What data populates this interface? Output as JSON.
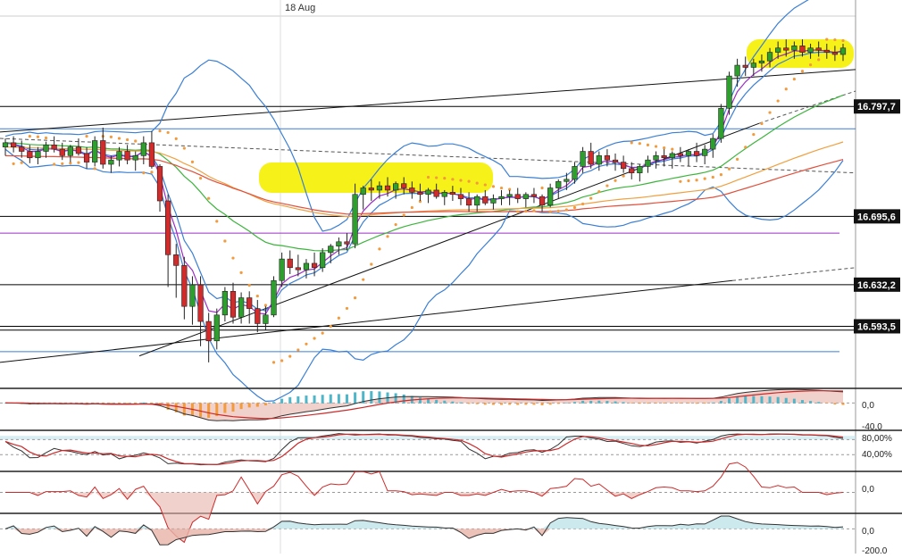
{
  "header": {
    "date_label": "18 Aug"
  },
  "colors": {
    "bull": "#2e9e2e",
    "bear": "#d12b2b",
    "bollinger": "#3a7fd5",
    "ema_fast": "#9b2fc4",
    "ema_mid": "#3cb43c",
    "ema_slow": "#e0503c",
    "ma_orange": "#f0a040",
    "sar": "#f39a3b",
    "highlight": "#f5f000",
    "level_line": "#000000",
    "hline_blue": "#3a7fd5",
    "hline_purple": "#9b2fc4",
    "macd_hist_pos": "#4fb6c9",
    "macd_hist_neg": "#f39a3b",
    "signal_red": "#cc2a2a",
    "panel_fill": "#bfe3ea",
    "neg_fill": "#e8b3a8"
  },
  "chart_data": [
    {
      "type": "candlestick",
      "title": "",
      "x_label": "18 Aug",
      "ylim": [
        16540,
        16880
      ],
      "price_labels": [
        "16.797,7",
        "16.695,6",
        "16.632,2",
        "16.593,5"
      ],
      "price_levels": [
        16797.7,
        16695.6,
        16632.2,
        16593.5
      ],
      "candles": [
        [
          16760,
          16768,
          16752,
          16764
        ],
        [
          16764,
          16770,
          16755,
          16760
        ],
        [
          16760,
          16766,
          16750,
          16756
        ],
        [
          16756,
          16762,
          16745,
          16750
        ],
        [
          16750,
          16760,
          16744,
          16756
        ],
        [
          16756,
          16765,
          16750,
          16762
        ],
        [
          16762,
          16770,
          16755,
          16758
        ],
        [
          16758,
          16764,
          16748,
          16752
        ],
        [
          16752,
          16762,
          16746,
          16760
        ],
        [
          16760,
          16768,
          16752,
          16754
        ],
        [
          16754,
          16760,
          16740,
          16746
        ],
        [
          16746,
          16770,
          16742,
          16766
        ],
        [
          16766,
          16778,
          16740,
          16744
        ],
        [
          16744,
          16752,
          16736,
          16748
        ],
        [
          16748,
          16760,
          16742,
          16756
        ],
        [
          16756,
          16762,
          16744,
          16748
        ],
        [
          16748,
          16756,
          16738,
          16752
        ],
        [
          16752,
          16770,
          16744,
          16764
        ],
        [
          16764,
          16775,
          16740,
          16742
        ],
        [
          16742,
          16744,
          16700,
          16710
        ],
        [
          16710,
          16716,
          16630,
          16660
        ],
        [
          16660,
          16670,
          16620,
          16650
        ],
        [
          16650,
          16658,
          16600,
          16612
        ],
        [
          16612,
          16640,
          16595,
          16632
        ],
        [
          16632,
          16640,
          16575,
          16598
        ],
        [
          16598,
          16606,
          16560,
          16580
        ],
        [
          16580,
          16610,
          16572,
          16604
        ],
        [
          16604,
          16630,
          16598,
          16626
        ],
        [
          16626,
          16634,
          16596,
          16602
        ],
        [
          16602,
          16625,
          16596,
          16620
        ],
        [
          16620,
          16626,
          16596,
          16610
        ],
        [
          16610,
          16618,
          16588,
          16596
        ],
        [
          16596,
          16612,
          16590,
          16604
        ],
        [
          16604,
          16640,
          16602,
          16636
        ],
        [
          16636,
          16662,
          16630,
          16656
        ],
        [
          16656,
          16664,
          16642,
          16648
        ],
        [
          16648,
          16660,
          16640,
          16646
        ],
        [
          16646,
          16656,
          16638,
          16652
        ],
        [
          16652,
          16662,
          16640,
          16648
        ],
        [
          16648,
          16666,
          16644,
          16662
        ],
        [
          16662,
          16670,
          16652,
          16668
        ],
        [
          16668,
          16676,
          16660,
          16672
        ],
        [
          16672,
          16680,
          16664,
          16670
        ],
        [
          16670,
          16726,
          16666,
          16716
        ],
        [
          16716,
          16724,
          16702,
          16722
        ],
        [
          16722,
          16730,
          16710,
          16720
        ],
        [
          16720,
          16728,
          16712,
          16724
        ],
        [
          16724,
          16732,
          16714,
          16720
        ],
        [
          16720,
          16728,
          16712,
          16726
        ],
        [
          16726,
          16732,
          16716,
          16722
        ],
        [
          16722,
          16728,
          16712,
          16718
        ],
        [
          16718,
          16726,
          16710,
          16716
        ],
        [
          16716,
          16722,
          16708,
          16720
        ],
        [
          16720,
          16726,
          16712,
          16714
        ],
        [
          16714,
          16720,
          16706,
          16718
        ],
        [
          16718,
          16724,
          16710,
          16716
        ],
        [
          16716,
          16722,
          16706,
          16712
        ],
        [
          16712,
          16718,
          16700,
          16706
        ],
        [
          16706,
          16716,
          16700,
          16714
        ],
        [
          16714,
          16720,
          16706,
          16708
        ],
        [
          16708,
          16716,
          16702,
          16712
        ],
        [
          16712,
          16720,
          16706,
          16714
        ],
        [
          16714,
          16720,
          16706,
          16716
        ],
        [
          16716,
          16722,
          16708,
          16712
        ],
        [
          16712,
          16718,
          16704,
          16716
        ],
        [
          16716,
          16722,
          16708,
          16714
        ],
        [
          16714,
          16716,
          16700,
          16706
        ],
        [
          16706,
          16726,
          16704,
          16722
        ],
        [
          16722,
          16730,
          16712,
          16728
        ],
        [
          16728,
          16736,
          16720,
          16730
        ],
        [
          16730,
          16746,
          16726,
          16742
        ],
        [
          16742,
          16760,
          16736,
          16756
        ],
        [
          16756,
          16764,
          16740,
          16744
        ],
        [
          16744,
          16756,
          16738,
          16752
        ],
        [
          16752,
          16758,
          16742,
          16748
        ],
        [
          16748,
          16754,
          16738,
          16746
        ],
        [
          16746,
          16752,
          16736,
          16740
        ],
        [
          16740,
          16746,
          16730,
          16736
        ],
        [
          16736,
          16744,
          16728,
          16742
        ],
        [
          16742,
          16752,
          16736,
          16748
        ],
        [
          16748,
          16756,
          16740,
          16752
        ],
        [
          16752,
          16758,
          16742,
          16750
        ],
        [
          16750,
          16756,
          16740,
          16754
        ],
        [
          16754,
          16760,
          16746,
          16752
        ],
        [
          16752,
          16758,
          16742,
          16756
        ],
        [
          16756,
          16764,
          16746,
          16752
        ],
        [
          16752,
          16762,
          16744,
          16758
        ],
        [
          16758,
          16772,
          16750,
          16768
        ],
        [
          16768,
          16800,
          16764,
          16796
        ],
        [
          16796,
          16830,
          16790,
          16826
        ],
        [
          16826,
          16842,
          16816,
          16836
        ],
        [
          16836,
          16844,
          16826,
          16834
        ],
        [
          16834,
          16842,
          16826,
          16838
        ],
        [
          16838,
          16846,
          16830,
          16840
        ],
        [
          16840,
          16852,
          16834,
          16848
        ],
        [
          16848,
          16858,
          16842,
          16852
        ],
        [
          16852,
          16860,
          16844,
          16850
        ],
        [
          16850,
          16858,
          16842,
          16854
        ],
        [
          16854,
          16860,
          16844,
          16848
        ],
        [
          16848,
          16856,
          16842,
          16852
        ],
        [
          16852,
          16858,
          16844,
          16850
        ],
        [
          16850,
          16856,
          16842,
          16848
        ],
        [
          16848,
          16854,
          16840,
          16846
        ],
        [
          16846,
          16856,
          16840,
          16852
        ]
      ]
    },
    {
      "type": "macd",
      "tick_labels": [
        "0,0",
        "-40,0"
      ],
      "ylim": [
        -60,
        30
      ]
    },
    {
      "type": "stochastic",
      "tick_labels": [
        "80,00%",
        "40,00%"
      ],
      "ylim": [
        0,
        100
      ]
    },
    {
      "type": "momentum",
      "tick_labels": [
        "0,0"
      ],
      "ylim": [
        -30,
        30
      ]
    },
    {
      "type": "cci",
      "tick_labels": [
        "0,0",
        "-200,0"
      ],
      "ylim": [
        -250,
        150
      ]
    }
  ]
}
